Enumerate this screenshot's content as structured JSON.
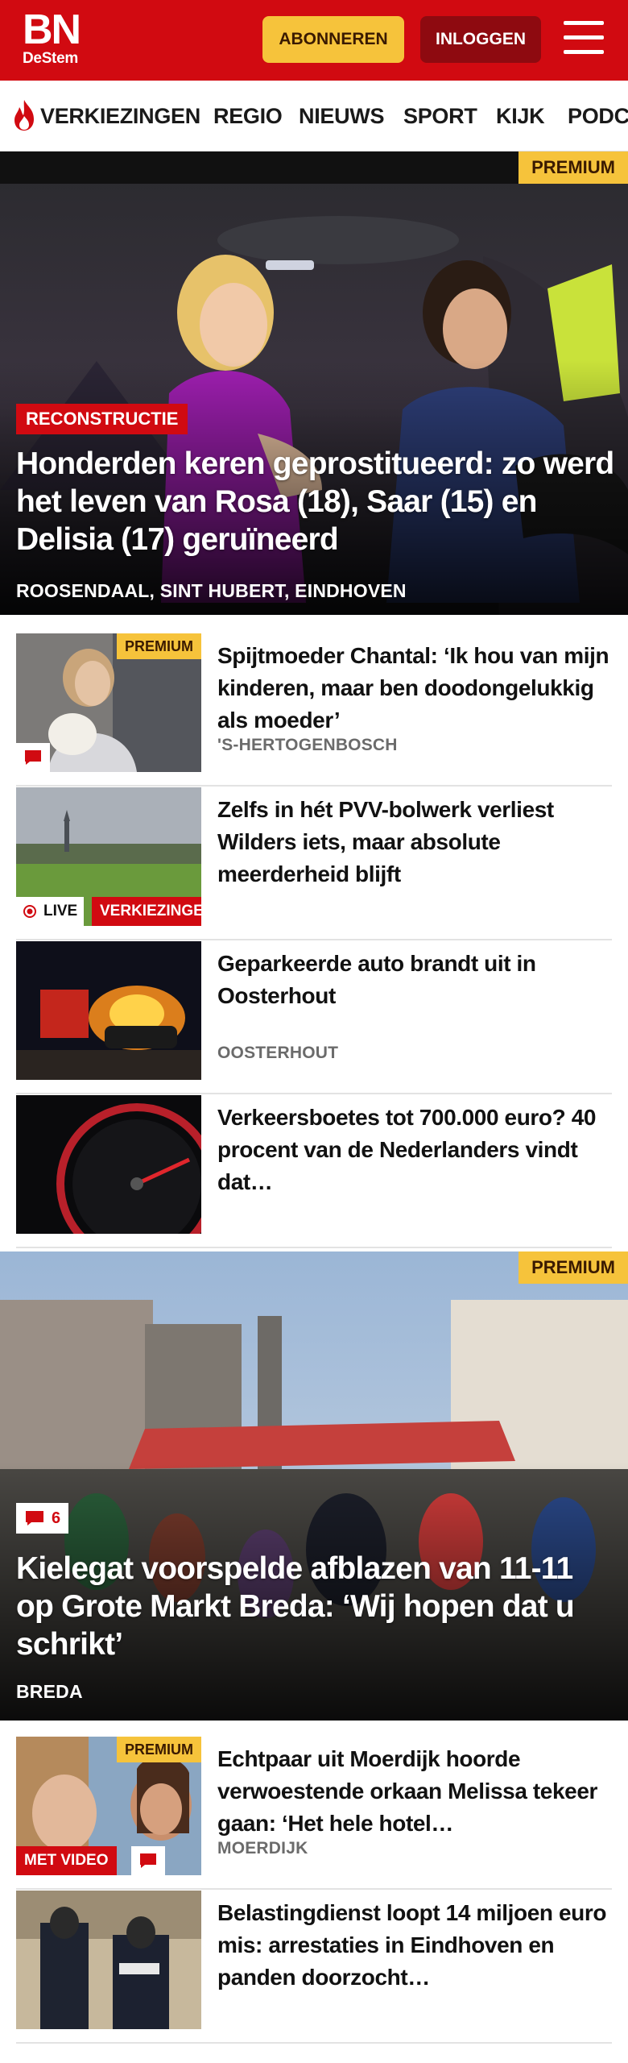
{
  "header": {
    "logo_main": "BN",
    "logo_sub": "DeStem",
    "subscribe_label": "ABONNEREN",
    "login_label": "INLOGGEN",
    "menu_icon": "hamburger-menu-icon"
  },
  "nav": {
    "items": [
      {
        "label": "VERKIEZINGEN",
        "icon": "flame-icon"
      },
      {
        "label": "REGIO"
      },
      {
        "label": "NIEUWS"
      },
      {
        "label": "SPORT"
      },
      {
        "label": "KIJK"
      },
      {
        "label": "PODC"
      }
    ]
  },
  "hero1": {
    "premium": "PREMIUM",
    "tag": "RECONSTRUCTIE",
    "title": "Honderden keren geprostitueerd: zo werd het leven van Rosa (18), Saar (15) en Delisia (17) geruïneerd",
    "location": "ROOSENDAAL, SINT HUBERT, EINDHOVEN"
  },
  "articles": [
    {
      "premium": "PREMIUM",
      "title": "Spijtmoeder Chantal: ‘Ik hou van mijn kinderen, maar ben doodongelukkig als moeder’",
      "location": "'S-HERTOGENBOSCH"
    },
    {
      "live": "LIVE",
      "tag": "VERKIEZINGEN",
      "title": "Zelfs in hét PVV-bolwerk verliest Wilders iets, maar absolute meerderheid blijft",
      "location": ""
    },
    {
      "title": "Geparkeerde auto brandt uit in Oosterhout",
      "location": "OOSTERHOUT"
    },
    {
      "title": "Verkeersboetes tot 700.000 euro? 40 procent van de Nederlanders vindt dat…",
      "location": ""
    }
  ],
  "hero2": {
    "premium": "PREMIUM",
    "comment_count": "6",
    "title": "Kielegat voorspelde afblazen van 11-11 op Grote Markt Breda: ‘Wij hopen dat u schrikt’",
    "location": "BREDA"
  },
  "articles2": [
    {
      "premium": "PREMIUM",
      "video": "MET VIDEO",
      "title": "Echtpaar uit Moerdijk hoorde verwoestende orkaan Melissa tekeer gaan: ‘Het hele hotel…",
      "location": "MOERDIJK"
    },
    {
      "title": "Belastingdienst loopt 14 miljoen euro mis: arrestaties in Eindhoven en panden doorzocht…",
      "location": ""
    }
  ],
  "colors": {
    "brand_red": "#d10a11",
    "premium_yellow": "#f6c33b",
    "login_dark_red": "#8e0a10"
  }
}
